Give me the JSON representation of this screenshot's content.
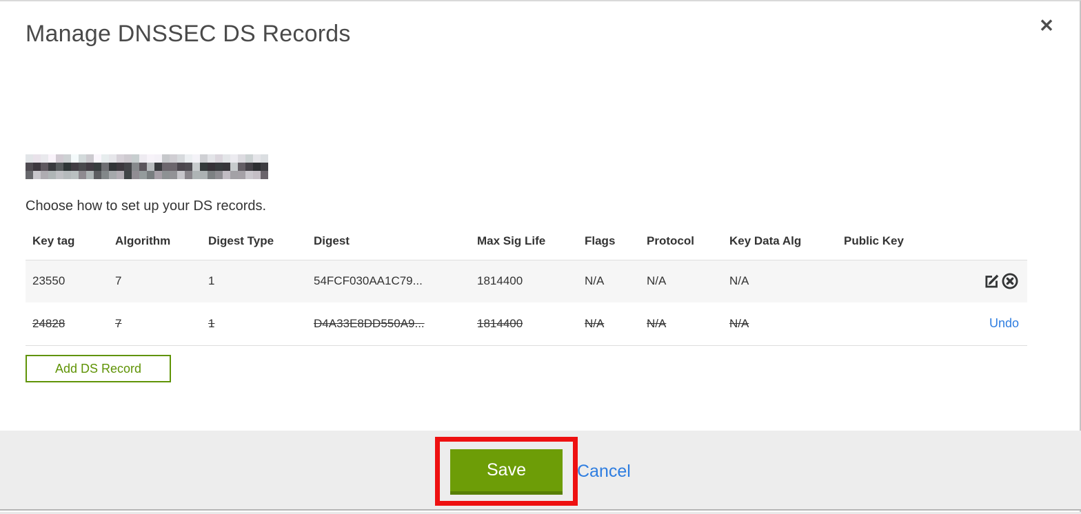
{
  "dialog": {
    "title": "Manage DNSSEC DS Records",
    "close_glyph": "✕",
    "instruction": "Choose how to set up your DS records."
  },
  "domain": {
    "redacted": true
  },
  "table": {
    "headers": [
      "Key tag",
      "Algorithm",
      "Digest Type",
      "Digest",
      "Max Sig Life",
      "Flags",
      "Protocol",
      "Key Data Alg",
      "Public Key"
    ],
    "rows": [
      {
        "key_tag": "23550",
        "algorithm": "7",
        "digest_type": "1",
        "digest": "54FCF030AA1C79...",
        "max_sig_life": "1814400",
        "flags": "N/A",
        "protocol": "N/A",
        "key_data_alg": "N/A",
        "public_key": "",
        "state": "active"
      },
      {
        "key_tag": "24828",
        "algorithm": "7",
        "digest_type": "1",
        "digest": "D4A33E8DD550A9...",
        "max_sig_life": "1814400",
        "flags": "N/A",
        "protocol": "N/A",
        "key_data_alg": "N/A",
        "public_key": "",
        "state": "deleted",
        "undo_label": "Undo"
      }
    ]
  },
  "buttons": {
    "add_ds_record": "Add DS Record",
    "save": "Save",
    "cancel": "Cancel"
  },
  "icons": {
    "edit": "edit-icon",
    "delete": "delete-icon",
    "close": "close-icon"
  },
  "colors": {
    "accent_green": "#6d9d07",
    "accent_green_dark": "#587f06",
    "outline_green": "#5f9305",
    "link_blue": "#2e7de0",
    "annotation_red": "#ee1111",
    "row_shade": "#f6f6f6"
  }
}
